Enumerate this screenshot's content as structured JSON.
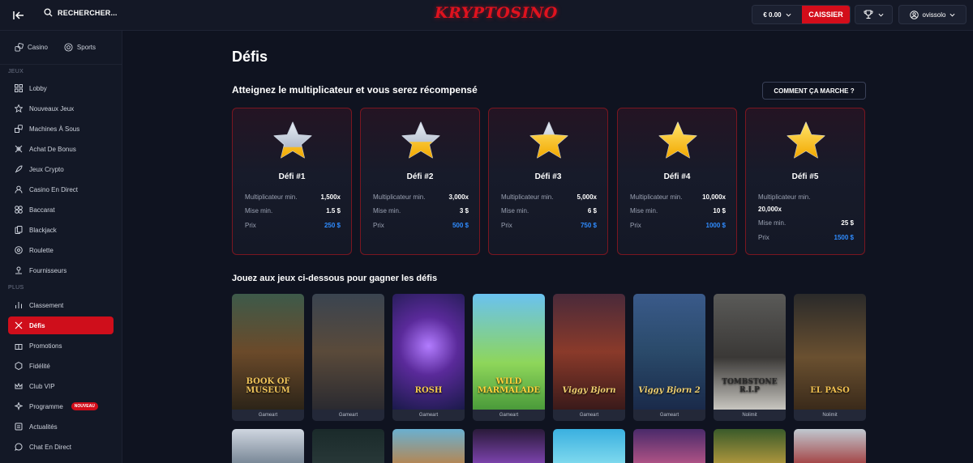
{
  "header": {
    "search_label": "RECHERCHER...",
    "logo_text": "KRYPTOSINO",
    "balance": "€ 0.00",
    "cashier_label": "CAISSIER",
    "username": "ovissolo"
  },
  "sidebar": {
    "tabs": [
      {
        "label": "Casino",
        "icon": "casino-icon"
      },
      {
        "label": "Sports",
        "icon": "sports-icon"
      }
    ],
    "section_games": "JEUX",
    "games_items": [
      {
        "label": "Lobby",
        "icon": "lobby-icon"
      },
      {
        "label": "Nouveaux Jeux",
        "icon": "star-icon"
      },
      {
        "label": "Machines À Sous",
        "icon": "slots-icon"
      },
      {
        "label": "Achat De Bonus",
        "icon": "bonus-buy-icon"
      },
      {
        "label": "Jeux Crypto",
        "icon": "rocket-icon"
      },
      {
        "label": "Casino En Direct",
        "icon": "live-casino-icon"
      },
      {
        "label": "Baccarat",
        "icon": "baccarat-icon"
      },
      {
        "label": "Blackjack",
        "icon": "blackjack-icon"
      },
      {
        "label": "Roulette",
        "icon": "roulette-icon"
      },
      {
        "label": "Fournisseurs",
        "icon": "providers-icon"
      }
    ],
    "section_more": "PLUS",
    "more_items": [
      {
        "label": "Classement",
        "icon": "leaderboard-icon"
      },
      {
        "label": "Défis",
        "icon": "challenges-icon",
        "active": true
      },
      {
        "label": "Promotions",
        "icon": "gift-icon"
      },
      {
        "label": "Fidélité",
        "icon": "loyalty-icon"
      },
      {
        "label": "Club VIP",
        "icon": "crown-icon"
      },
      {
        "label": "Programme",
        "icon": "referral-icon",
        "badge": "NOUVEAU"
      },
      {
        "label": "Actualités",
        "icon": "news-icon"
      },
      {
        "label": "Chat En Direct",
        "icon": "chat-icon"
      }
    ]
  },
  "main": {
    "title": "Défis",
    "subtitle": "Atteignez le multiplicateur et vous serez récompensé",
    "how_button": "COMMENT ÇA MARCHE ?",
    "row_labels": {
      "multiplier": "Multiplicateur min.",
      "min_bet": "Mise min.",
      "prize": "Prix"
    },
    "challenges": [
      {
        "title": "Défi #1",
        "multiplier": "1,500x",
        "min_bet": "1.5 $",
        "prize": "250 $",
        "star_fill": 0.3
      },
      {
        "title": "Défi #2",
        "multiplier": "3,000x",
        "min_bet": "3 $",
        "prize": "500 $",
        "star_fill": 0.45
      },
      {
        "title": "Défi #3",
        "multiplier": "5,000x",
        "min_bet": "6 $",
        "prize": "750 $",
        "star_fill": 0.65
      },
      {
        "title": "Défi #4",
        "multiplier": "10,000x",
        "min_bet": "10 $",
        "prize": "1000 $",
        "star_fill": 1.0
      },
      {
        "title": "Défi #5",
        "multiplier": "20,000x",
        "min_bet": "25 $",
        "prize": "1500 $",
        "star_fill": 1.0
      }
    ],
    "games_title": "Jouez aux jeux ci-dessous pour gagner les défis",
    "games": [
      {
        "name": "BOOK OF MUSEUM",
        "provider": "Gameart"
      },
      {
        "name": "",
        "provider": "Gameart"
      },
      {
        "name": "ROSH",
        "provider": "Gameart"
      },
      {
        "name": "WILD MARMALADE",
        "provider": "Gameart"
      },
      {
        "name": "Viggy Bjorn",
        "provider": "Gameart"
      },
      {
        "name": "Viggy Bjorn 2",
        "provider": "Gameart"
      },
      {
        "name": "TOMBSTONE R.I.P",
        "provider": "Nolimit"
      },
      {
        "name": "EL PASO",
        "provider": "Nolimit"
      }
    ]
  },
  "colors": {
    "accent": "#d30d1a",
    "prize": "#2f8cff",
    "bg": "#0f1320"
  }
}
